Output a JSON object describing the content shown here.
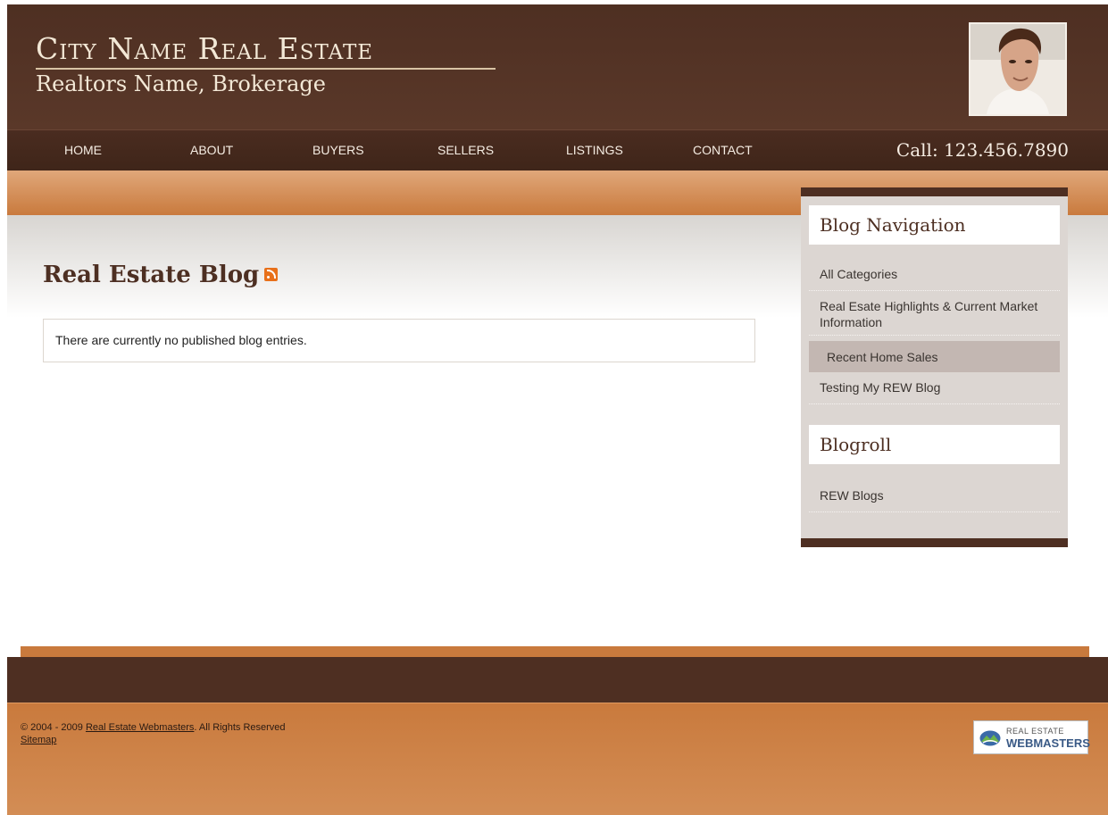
{
  "header": {
    "brand_title": "City Name Real Estate",
    "brand_subtitle": "Realtors Name, Brokerage",
    "phone": "Call: 123.456.7890"
  },
  "nav": {
    "items": [
      {
        "label": "HOME"
      },
      {
        "label": "ABOUT"
      },
      {
        "label": "BUYERS"
      },
      {
        "label": "SELLERS"
      },
      {
        "label": "LISTINGS"
      },
      {
        "label": "CONTACT"
      }
    ]
  },
  "main": {
    "title": "Real Estate Blog",
    "message": "There are currently no published blog entries."
  },
  "sidebar": {
    "blog_nav_heading": "Blog Navigation",
    "blog_nav_items": [
      {
        "label": "All Categories"
      },
      {
        "label": "Real Esate Highlights & Current Market Information"
      },
      {
        "label": "Recent Home Sales"
      },
      {
        "label": "Testing My REW Blog"
      }
    ],
    "blogroll_heading": "Blogroll",
    "blogroll_items": [
      {
        "label": "REW Blogs"
      }
    ]
  },
  "footer": {
    "copyright_prefix": "© 2004 - 2009",
    "company_link": "Real Estate Webmasters",
    "copyright_suffix": ". All Rights Reserved",
    "sitemap_link": "Sitemap",
    "logo_line1": "REAL ESTATE",
    "logo_line2": "WEBMASTERS"
  },
  "colors": {
    "header_brown": "#4e2f22",
    "accent_orange": "#c97a3d",
    "sidebar_grey": "#dcd6d2"
  },
  "icons": {
    "rss": "rss-feed-icon",
    "avatar": "agent-photo"
  }
}
